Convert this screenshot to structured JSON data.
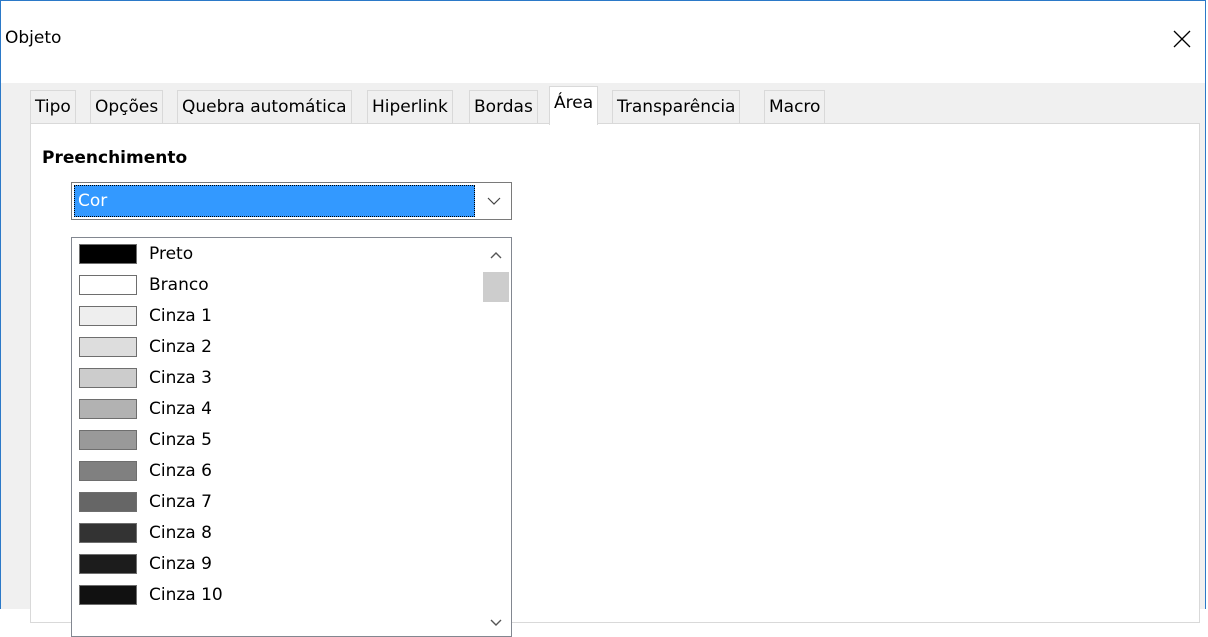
{
  "window": {
    "title": "Objeto"
  },
  "tabs": [
    {
      "label": "Tipo"
    },
    {
      "label": "Opções"
    },
    {
      "label": "Quebra automática"
    },
    {
      "label": "Hiperlink"
    },
    {
      "label": "Bordas"
    },
    {
      "label": "Área",
      "active": true
    },
    {
      "label": "Transparência"
    },
    {
      "label": "Macro"
    }
  ],
  "area": {
    "fill_heading": "Preenchimento",
    "fill_type": "Cor",
    "colors": [
      {
        "name": "Preto",
        "color": "#000000"
      },
      {
        "name": "Branco",
        "color": "#ffffff"
      },
      {
        "name": "Cinza 1",
        "color": "#eeeeee"
      },
      {
        "name": "Cinza 2",
        "color": "#dddddd"
      },
      {
        "name": "Cinza 3",
        "color": "#cccccc"
      },
      {
        "name": "Cinza 4",
        "color": "#b2b2b2"
      },
      {
        "name": "Cinza 5",
        "color": "#999999"
      },
      {
        "name": "Cinza 6",
        "color": "#808080"
      },
      {
        "name": "Cinza 7",
        "color": "#666666"
      },
      {
        "name": "Cinza 8",
        "color": "#333333"
      },
      {
        "name": "Cinza 9",
        "color": "#1c1c1c"
      },
      {
        "name": "Cinza 10",
        "color": "#111111"
      }
    ]
  }
}
